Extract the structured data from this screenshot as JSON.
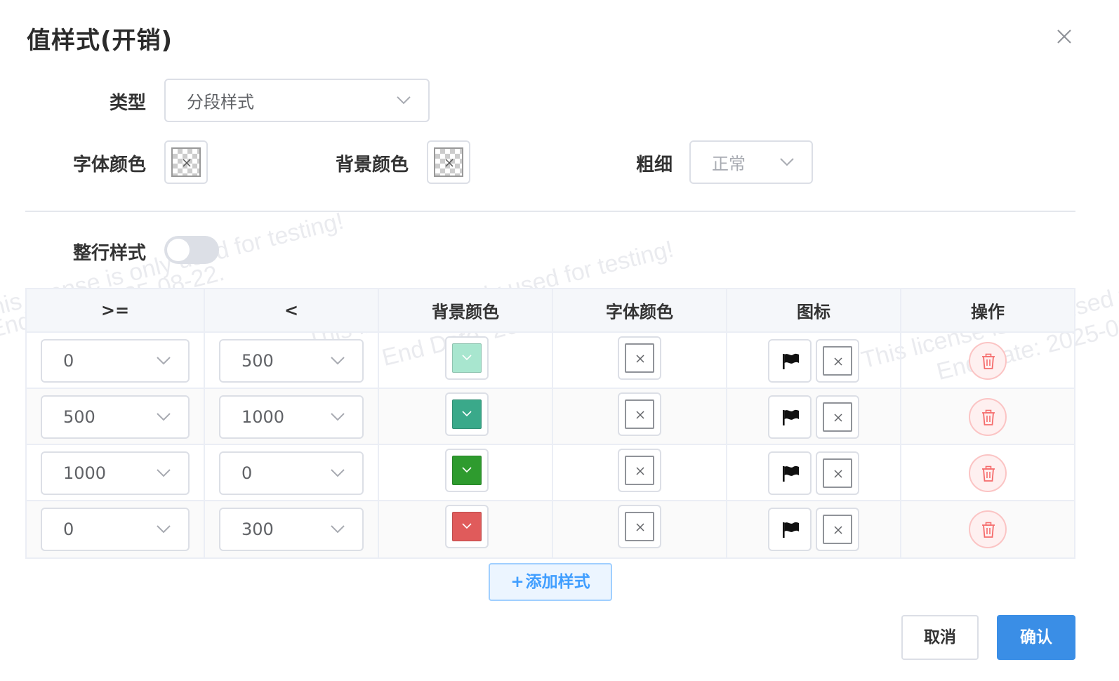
{
  "dialog": {
    "title": "值样式(开销)"
  },
  "form": {
    "type_label": "类型",
    "type_value": "分段样式",
    "font_color_label": "字体颜色",
    "bg_color_label": "背景颜色",
    "weight_label": "粗细",
    "weight_value": "正常",
    "row_style_label": "整行样式",
    "row_style_on": false
  },
  "table": {
    "columns": [
      ">=",
      "<",
      "背景颜色",
      "字体颜色",
      "图标",
      "操作"
    ],
    "rows": [
      {
        "gte": "0",
        "lt": "500",
        "bg_color": "#a8e6cf",
        "icon": "flag-icon"
      },
      {
        "gte": "500",
        "lt": "1000",
        "bg_color": "#3aa98a",
        "icon": "flag-icon"
      },
      {
        "gte": "1000",
        "lt": "0",
        "bg_color": "#2e9b2e",
        "icon": "flag-icon"
      },
      {
        "gte": "0",
        "lt": "300",
        "bg_color": "#e05b5b",
        "icon": "flag-icon"
      }
    ]
  },
  "actions": {
    "add_style": "添加样式",
    "cancel": "取消",
    "confirm": "确认"
  },
  "watermark": {
    "line1": "This license is only used for testing!",
    "line2": "End Date: 2025-08-22."
  },
  "colors": {
    "primary": "#3a8ee6",
    "danger": "#f56c6c",
    "border": "#dcdfe6"
  }
}
